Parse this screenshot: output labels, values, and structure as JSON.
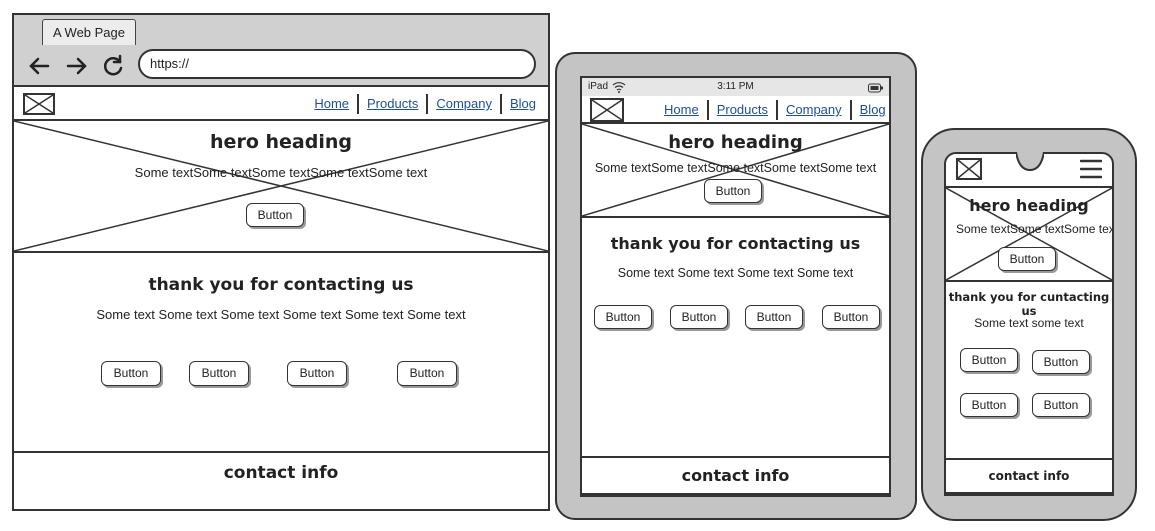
{
  "desktop": {
    "tab_label": "A Web Page",
    "url": "https://",
    "nav": [
      "Home",
      "Products",
      "Company",
      "Blog"
    ],
    "hero": {
      "heading": "hero heading",
      "text": "Some textSome textSome textSome textSome text",
      "button": "Button"
    },
    "thanks": {
      "heading": "thank you for contacting us",
      "text": "Some text Some text Some text Some text Some text Some text",
      "buttons": [
        "Button",
        "Button",
        "Button",
        "Button"
      ]
    },
    "footer": "contact info"
  },
  "tablet": {
    "status": {
      "device": "iPad",
      "time": "3:11 PM"
    },
    "nav": [
      "Home",
      "Products",
      "Company",
      "Blog"
    ],
    "hero": {
      "heading": "hero heading",
      "text": "Some textSome textSome textSome textSome text",
      "button": "Button"
    },
    "thanks": {
      "heading": "thank you for contacting us",
      "text": "Some text Some text Some text Some text",
      "buttons": [
        "Button",
        "Button",
        "Button",
        "Button"
      ]
    },
    "footer": "contact info"
  },
  "phone": {
    "hero": {
      "heading": "hero heading",
      "text": "Some textSome textSome text",
      "button": "Button"
    },
    "thanks": {
      "heading": "thank you for cuntacting us",
      "text": "Some text some text",
      "buttons": [
        "Button",
        "Button",
        "Button",
        "Button"
      ]
    },
    "footer": "contact info"
  },
  "icons": {
    "back": "arrow-left-icon",
    "forward": "arrow-right-icon",
    "reload": "reload-icon",
    "wifi": "wifi-icon",
    "battery": "battery-icon",
    "menu": "hamburger-menu-icon",
    "image_placeholder": "image-placeholder-icon"
  }
}
